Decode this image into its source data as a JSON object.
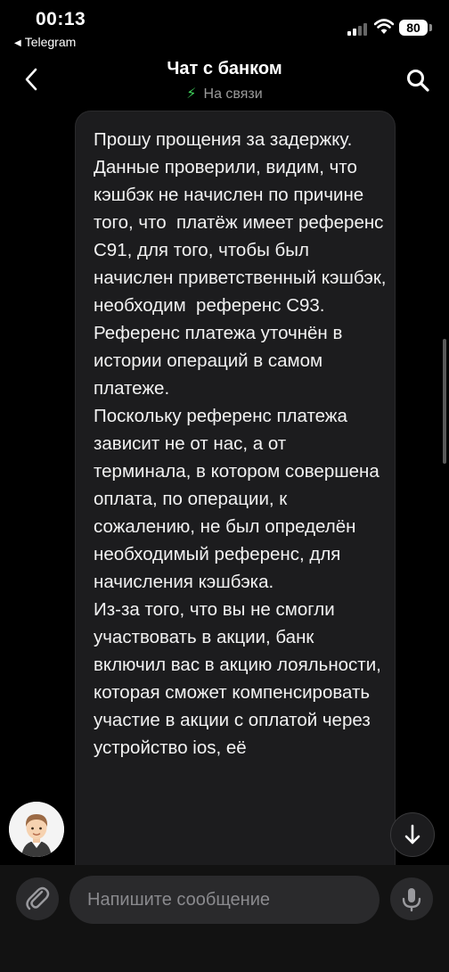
{
  "status_bar": {
    "time": "00:13",
    "back_app": "Telegram",
    "battery": "80",
    "icons": [
      "signal-icon",
      "wifi-icon",
      "battery-icon"
    ]
  },
  "header": {
    "title": "Чат с банком",
    "subtitle": "На связи",
    "status_color": "#3fd35b",
    "icons": [
      "back-arrow-icon",
      "bolt-icon",
      "search-icon"
    ]
  },
  "message": {
    "text": "Прошу прощения за задержку.\nДанные проверили, видим, что кэшбэк не начислен по причине того, что  платёж имеет референс С91, для того, чтобы был начислен приветственный кэшбэк, необходим  референс С93. Референс платежа уточнён в истории операций в самом платеже.\nПоскольку референс платежа зависит не от нас, а от терминала, в котором совершена оплата, по операции, к сожалению, не был определён необходимый референс, для начисления кэшбэка.\nИз-за того, что вы не смогли участвовать в акции, банк включил вас в акцию лояльности, которая сможет компенсировать участие в акции с оплатой через устройство ios, её"
  },
  "composer": {
    "placeholder": "Напишите сообщение",
    "icons": [
      "paperclip-icon",
      "microphone-icon"
    ]
  },
  "scroll": {
    "icon": "arrow-down-icon"
  }
}
